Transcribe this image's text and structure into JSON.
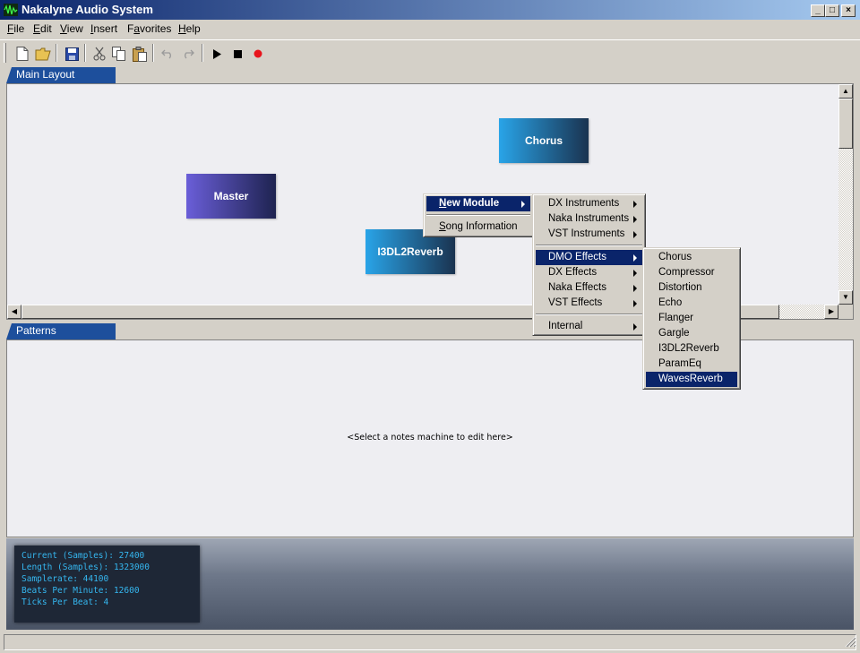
{
  "window": {
    "title": "Nakalyne Audio System",
    "controls": {
      "minimize": "_",
      "maximize": "□",
      "close": "×"
    }
  },
  "menubar": {
    "items": [
      {
        "pre": "",
        "key": "F",
        "post": "ile"
      },
      {
        "pre": "",
        "key": "E",
        "post": "dit"
      },
      {
        "pre": "",
        "key": "V",
        "post": "iew"
      },
      {
        "pre": "",
        "key": "I",
        "post": "nsert"
      },
      {
        "pre": "F",
        "key": "a",
        "post": "vorites"
      },
      {
        "pre": "",
        "key": "H",
        "post": "elp"
      }
    ]
  },
  "toolbar": {
    "buttons": [
      "new-file-icon",
      "open-folder-icon",
      "save-icon",
      "cut-icon",
      "copy-icon",
      "paste-icon",
      "undo-icon",
      "redo-icon",
      "play-icon",
      "stop-icon",
      "record-icon"
    ]
  },
  "main_layout": {
    "tab_label": "Main Layout",
    "modules": [
      "Chorus",
      "Master",
      "I3DL2Reverb"
    ]
  },
  "patterns": {
    "tab_label": "Patterns",
    "placeholder": "<Select a notes machine to edit here>"
  },
  "context_menu": {
    "items": [
      {
        "pre": "",
        "key": "N",
        "post": "ew Module"
      },
      {
        "pre": "",
        "key": "S",
        "post": "ong Information"
      }
    ]
  },
  "submenu": {
    "items": [
      "DX Instruments",
      "Naka Instruments",
      "VST Instruments",
      "DMO Effects",
      "DX Effects",
      "Naka Effects",
      "VST Effects",
      "Internal"
    ]
  },
  "dmo_menu": {
    "items": [
      "Chorus",
      "Compressor",
      "Distortion",
      "Echo",
      "Flanger",
      "Gargle",
      "I3DL2Reverb",
      "ParamEq",
      "WavesReverb"
    ]
  },
  "info": {
    "lines": [
      "Current (Samples): 27400",
      "Length (Samples): 1323000",
      "Samplerate: 44100",
      "Beats Per Minute: 12600",
      "Ticks Per Beat: 4"
    ]
  },
  "colors": {
    "titlebar_start": "#0a246a",
    "titlebar_end": "#a6caf0",
    "tab": "#1d4f9c",
    "highlight": "#0a246a",
    "info_text": "#35b7f0",
    "record": "#e8141c"
  }
}
